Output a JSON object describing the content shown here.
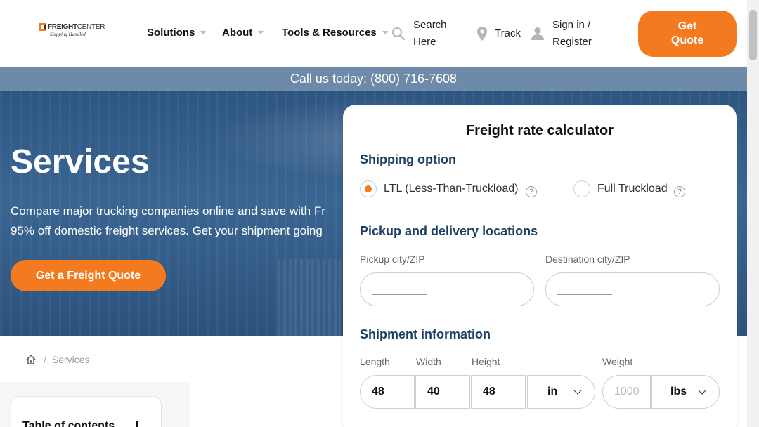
{
  "header": {
    "logo": {
      "name_bold": "FREIGHT",
      "name_rest": "CENTER",
      "tagline": "Shipping Handled."
    },
    "nav": [
      {
        "label": "Solutions"
      },
      {
        "label": "About"
      },
      {
        "label": "Tools & Resources"
      }
    ],
    "search": {
      "line1": "Search",
      "line2": "Here",
      "icon": "search-icon"
    },
    "track": {
      "label": "Track",
      "icon": "location-pin-icon"
    },
    "signin": {
      "line1": "Sign in /",
      "line2": "Register",
      "icon": "user-icon"
    },
    "cta": {
      "line1": "Get",
      "line2": "Quote"
    }
  },
  "callbar": {
    "text": "Call us today: (800) 716-7608"
  },
  "hero": {
    "title": "Services",
    "line1": "Compare major trucking companies online and save with Fr",
    "line2": "95% off domestic freight services. Get your shipment going",
    "cta": "Get a Freight Quote"
  },
  "breadcrumb": {
    "home_icon": "home-icon",
    "separator": "/",
    "current": "Services"
  },
  "toc": {
    "title": "Table of contents"
  },
  "calculator": {
    "title": "Freight rate calculator",
    "shipping_option_heading": "Shipping option",
    "options": [
      {
        "label": "LTL (Less-Than-Truckload)",
        "selected": true
      },
      {
        "label": "Full Truckload",
        "selected": false
      }
    ],
    "locations_heading": "Pickup and delivery locations",
    "pickup_label": "Pickup city/ZIP",
    "destination_label": "Destination city/ZIP",
    "shipment_heading": "Shipment information",
    "length_label": "Length",
    "width_label": "Width",
    "height_label": "Height",
    "weight_label": "Weight",
    "length_value": "48",
    "width_value": "40",
    "height_value": "48",
    "dim_unit": "in",
    "weight_placeholder": "1000",
    "weight_unit": "lbs",
    "help_glyph": "?"
  },
  "colors": {
    "accent": "#f47a20",
    "navy": "#1d3f63",
    "callbar": "#6d8aa8"
  }
}
